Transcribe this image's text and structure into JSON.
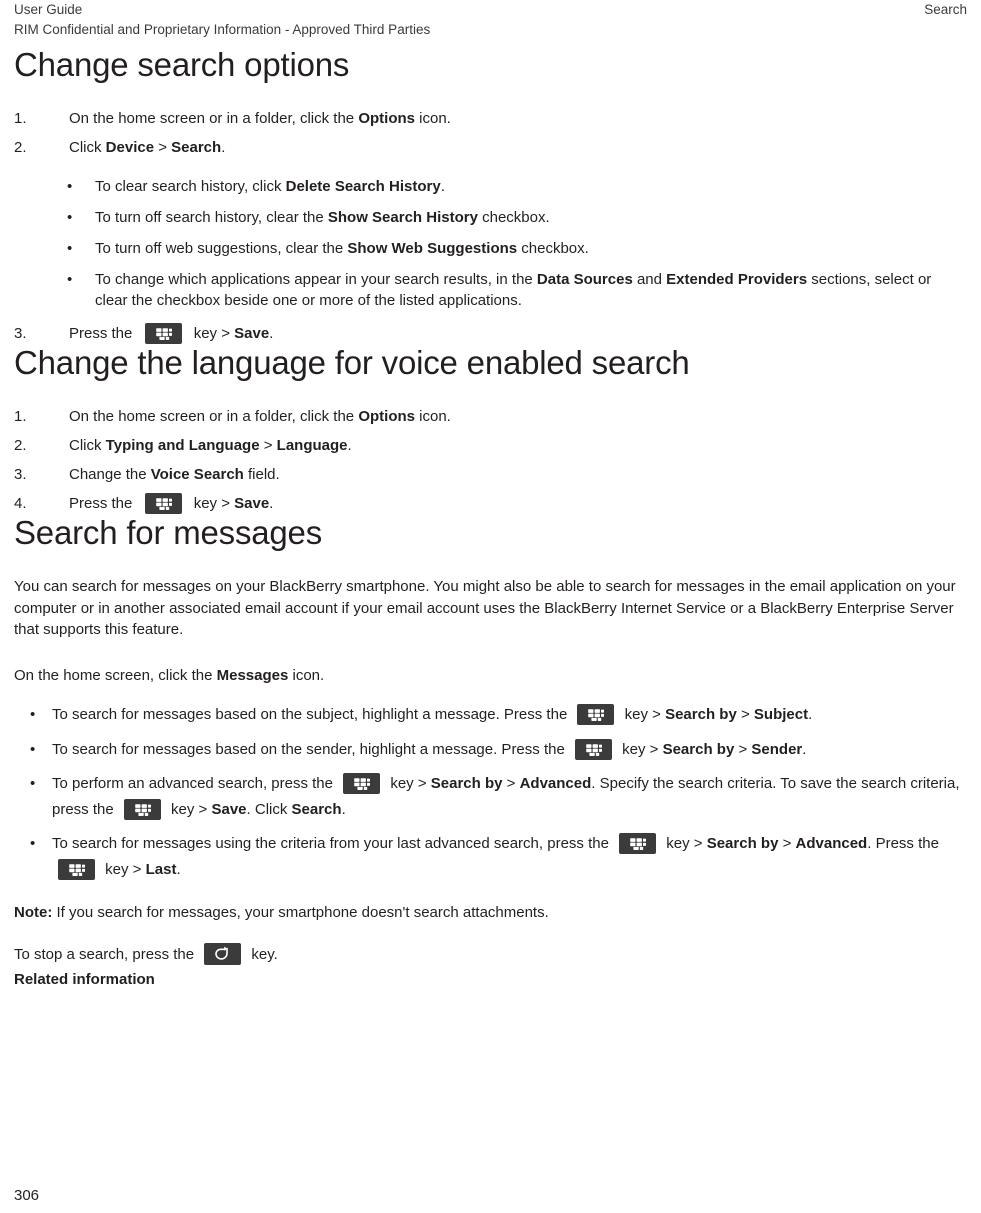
{
  "header": {
    "left_line1": "User Guide",
    "left_line2": "RIM Confidential and Proprietary Information - Approved Third Parties",
    "right": "Search"
  },
  "sections": [
    {
      "id": "change-search-options",
      "title": "Change search options",
      "steps": [
        {
          "num": "1.",
          "pre": "On the home screen or in a folder, click the ",
          "bold": "Options",
          "post": " icon."
        },
        {
          "num": "2.",
          "pre": "Click ",
          "bold": "Device",
          "mid": " > ",
          "bold2": "Search",
          "post": "."
        }
      ],
      "sub_bullets": [
        {
          "bullet": "•",
          "pre": "To clear search history, click ",
          "bold": "Delete Search History",
          "post": "."
        },
        {
          "bullet": "•",
          "pre": "To turn off search history, clear the ",
          "bold": "Show Search History",
          "post": " checkbox."
        },
        {
          "bullet": "•",
          "pre": "To turn off web suggestions, clear the ",
          "bold": "Show Web Suggestions",
          "post": " checkbox."
        },
        {
          "bullet": "•",
          "pre": "To change which applications appear in your search results, in the ",
          "bold": "Data Sources",
          "mid": " and ",
          "bold2": "Extended Providers",
          "post": " sections, select or clear the checkbox beside one or more of the listed applications."
        }
      ],
      "final_step": {
        "num": "3.",
        "pre": "Press the ",
        "icon": "blackberry-menu-key-icon",
        "mid": " key > ",
        "bold": "Save",
        "post": "."
      }
    },
    {
      "id": "change-language-voice-search",
      "title": "Change the language for voice enabled search",
      "steps": [
        {
          "num": "1.",
          "pre": "On the home screen or in a folder, click the ",
          "bold": "Options",
          "post": " icon."
        },
        {
          "num": "2.",
          "pre": "Click ",
          "bold": "Typing and Language",
          "mid": " > ",
          "bold2": "Language",
          "post": "."
        },
        {
          "num": "3.",
          "pre": "Change the ",
          "bold": "Voice Search",
          "post": " field."
        },
        {
          "num": "4.",
          "pre": "Press the ",
          "icon": "blackberry-menu-key-icon",
          "mid": " key > ",
          "bold": "Save",
          "post": "."
        }
      ]
    },
    {
      "id": "search-for-messages",
      "title": "Search for messages",
      "intro": "You can search for messages on your BlackBerry smartphone. You might also be able to search for messages in the email application on your computer or in another associated email account if your email account uses the BlackBerry Internet Service or a BlackBerry Enterprise Server that supports this feature.",
      "lead_pre": "On the home screen, click the ",
      "lead_bold": "Messages",
      "lead_post": " icon.",
      "bullets": [
        {
          "bullet": "•",
          "p1": "To search for messages based on the subject, highlight a message. Press the ",
          "icon1": "blackberry-menu-key-icon",
          "p2": " key > ",
          "b1": "Search by",
          "p3": " > ",
          "b2": "Subject",
          "p4": "."
        },
        {
          "bullet": "•",
          "p1": "To search for messages based on the sender, highlight a message. Press the ",
          "icon1": "blackberry-menu-key-icon",
          "p2": " key > ",
          "b1": "Search by",
          "p3": " > ",
          "b2": "Sender",
          "p4": "."
        },
        {
          "bullet": "•",
          "p1": "To perform an advanced search, press the ",
          "icon1": "blackberry-menu-key-icon",
          "p2": " key > ",
          "b1": "Search by",
          "p3": " > ",
          "b2": "Advanced",
          "p4": ". Specify the search criteria. To save the search criteria, press the ",
          "icon2": "blackberry-menu-key-icon",
          "p5": " key > ",
          "b3": "Save",
          "p6": ". Click ",
          "b4": "Search",
          "p7": "."
        },
        {
          "bullet": "•",
          "p1": "To search for messages using the criteria from your last advanced search, press the ",
          "icon1": "blackberry-menu-key-icon",
          "p2": " key > ",
          "b1": "Search by",
          "p3": " > ",
          "b2": "Advanced",
          "p4": ". Press the ",
          "icon2": "blackberry-menu-key-icon",
          "p5": " key > ",
          "b3": "Last",
          "p6": "."
        }
      ],
      "note_label": "Note:",
      "note_text": " If you search for messages, your smartphone doesn't search attachments.",
      "stop_pre": "To stop a search, press the ",
      "stop_icon": "escape-key-icon",
      "stop_post": " key.",
      "related_information": "Related information"
    }
  ],
  "page_number": "306",
  "colors": {
    "text": "#231f20",
    "header_text": "#3b3b3b",
    "keycap_background": "#3b3b3b",
    "keycap_glyph": "#ffffff",
    "page_background": "#ffffff"
  }
}
